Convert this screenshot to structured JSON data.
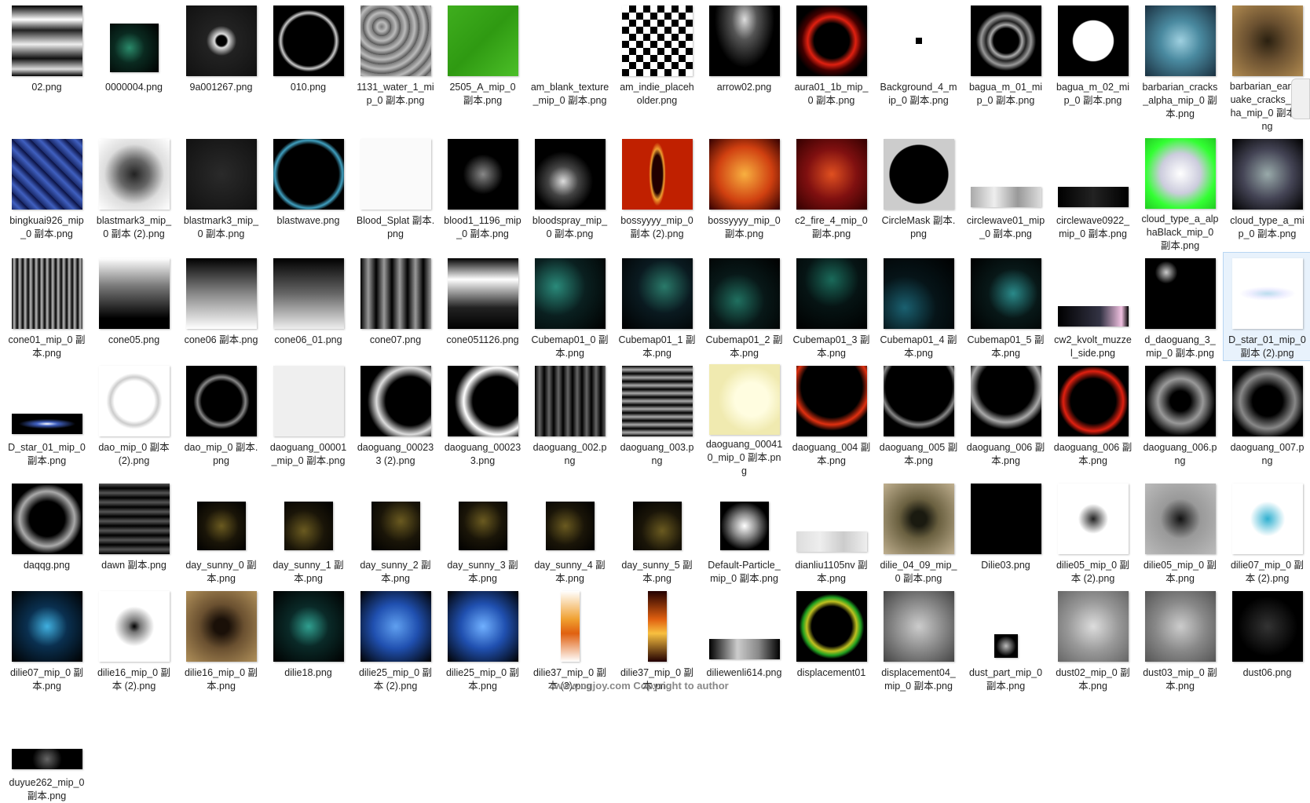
{
  "files": [
    {
      "name": "02.png",
      "bg": "linear-gradient(180deg,#000 0%,#fff 20%,#222 35%,#eee 55%,#111 75%,#ddd 90%,#000 100%)"
    },
    {
      "name": "0000004.png",
      "bg": "radial-gradient(circle at 40% 50%,#2a8a6a 0%,#0a2a20 40%,#000 100%)",
      "small": true
    },
    {
      "name": "9a001267.png",
      "bg": "radial-gradient(circle,#000 10%,#ddd 14%,#222 30%,#111 100%)"
    },
    {
      "name": "010.png",
      "bg": "radial-gradient(circle,#000 50%,#ccc 56%,#000 62%,#000 100%)"
    },
    {
      "name": "1131_water_1_mip_0 副本.png",
      "bg": "repeating-radial-gradient(circle at 30% 30%,#777 0,#bbb 6px,#555 12px)"
    },
    {
      "name": "2505_A_mip_0 副本.png",
      "bg": "linear-gradient(135deg,#3fae1e,#2f9a12,#4cbf28)"
    },
    {
      "name": "am_blank_texture_mip_0 副本.png",
      "bg": "transparent",
      "blank": true
    },
    {
      "name": "am_indie_placeholder.png",
      "bg": "repeating-conic-gradient(#000 0% 25%,#fff 0% 50%) 0 0/18px 18px"
    },
    {
      "name": "arrow02.png",
      "bg": "radial-gradient(ellipse at 50% 20%,#ddd 0%,#555 25%,#000 60%)"
    },
    {
      "name": "aura01_1b_mip_0 副本.png",
      "bg": "radial-gradient(circle,#000 35%,#e02010 48%,#400 60%,#000 75%)"
    },
    {
      "name": "Background_4_mip_0 副本.png",
      "bg": "transparent",
      "blank": true
    },
    {
      "name": "bagua_m_01_mip_0 副本.png",
      "bg": "radial-gradient(circle,#000 25%,#aaa 32%,#222 40%,#999 50%,#000 60%)"
    },
    {
      "name": "bagua_m_02_mip_0 副本.png",
      "bg": "radial-gradient(circle,#fff 40%,#000 42%,#000 100%)"
    },
    {
      "name": "barbarian_cracks_alpha_mip_0 副本.png",
      "bg": "radial-gradient(circle,#9fd0e0 0%,#4a8aa0 40%,#1a3040 100%)"
    },
    {
      "name": "barbarian_earthquake_cracks_alpha_mip_0 副本.png",
      "bg": "radial-gradient(circle,#2a2010 0%,#6a5030 40%,#b08a50 100%)"
    },
    {
      "name": "bingkuai926_mip_0 副本.png",
      "bg": "repeating-linear-gradient(45deg,#1a2a6a 0,#4060c0 8px,#0a1040 16px)"
    },
    {
      "name": "blastmark3_mip_0 副本 (2).png",
      "bg": "radial-gradient(circle,#222 0%,#666 30%,#ddd 60%,#fff 100%)"
    },
    {
      "name": "blastmark3_mip_0 副本.png",
      "bg": "radial-gradient(circle,#2a2a2a 0%,#111 100%)"
    },
    {
      "name": "blastwave.png",
      "bg": "radial-gradient(circle,#000 60%,#40a0c0 68%,#000 75%)"
    },
    {
      "name": "Blood_Splat 副本.png",
      "bg": "#fafafa"
    },
    {
      "name": "blood1_1196_mip_0 副本.png",
      "bg": "radial-gradient(circle at 50% 50%,#888 0%,#000 40%)"
    },
    {
      "name": "bloodspray_mip_0 副本.png",
      "bg": "radial-gradient(circle at 40% 60%,#ddd 0%,#444 25%,#000 50%)"
    },
    {
      "name": "bossyyyy_mip_0 副本 (2).png",
      "bg": "radial-gradient(ellipse 12% 45%,#200 60%,#f0a030 80%,#c02000 100%),radial-gradient(circle,#f8c050 0%,#e06010 50%,#fff 80%)"
    },
    {
      "name": "bossyyyy_mip_0 副本.png",
      "bg": "radial-gradient(circle,#f8b040 0%,#d04010 55%,#300 100%)"
    },
    {
      "name": "c2_fire_4_mip_0 副本.png",
      "bg": "radial-gradient(circle,#e05020 0%,#801010 50%,#300 100%)"
    },
    {
      "name": "CircleMask 副本.png",
      "bg": "radial-gradient(circle,#000 58%,#ccc 60%)"
    },
    {
      "name": "circlewave01_mip_0 副本.png",
      "bg": "transparent",
      "strip": "linear-gradient(90deg,#aaa,#eee,#999,#ddd)"
    },
    {
      "name": "circlewave0922_mip_0 副本.png",
      "bg": "transparent",
      "strip": "linear-gradient(90deg,#000,#222,#000)"
    },
    {
      "name": "cloud_type_a_alphaBlack_mip_0 副本.png",
      "bg": "radial-gradient(circle,#fff 0%,#ccd 40%,#3f3 70%,#2c2 100%)"
    },
    {
      "name": "cloud_type_a_mip_0 副本.png",
      "bg": "radial-gradient(circle,#9aa 0%,#445 50%,#000 100%)"
    },
    {
      "name": "cone01_mip_0 副本.png",
      "bg": "repeating-linear-gradient(90deg,#000 0,#bbb 3px,#000 7px)"
    },
    {
      "name": "cone05.png",
      "bg": "linear-gradient(180deg,#fff 0%,#777 40%,#000 85%)"
    },
    {
      "name": "cone06 副本.png",
      "bg": "linear-gradient(180deg,#000 0%,#888 50%,#fff 100%)"
    },
    {
      "name": "cone06_01.png",
      "bg": "linear-gradient(180deg,#000 0%,#666 50%,#eee 100%)"
    },
    {
      "name": "cone07.png",
      "bg": "repeating-linear-gradient(90deg,#000 0,#999 10px,#000 20px)"
    },
    {
      "name": "cone051126.png",
      "bg": "linear-gradient(180deg,#000 0%,#fff 30%,#222 70%,#000 100%)"
    },
    {
      "name": "Cubemap01_0 副本.png",
      "bg": "radial-gradient(circle at 30% 40%,#2a8a7a 0%,#0a2020 45%,#000 100%)"
    },
    {
      "name": "Cubemap01_1 副本.png",
      "bg": "radial-gradient(circle at 60% 40%,#2a7a6a 0%,#0a1a20 45%,#000 100%)"
    },
    {
      "name": "Cubemap01_2 副本.png",
      "bg": "radial-gradient(circle at 40% 60%,#207060 0%,#081818 45%,#000 100%)"
    },
    {
      "name": "Cubemap01_3 副本.png",
      "bg": "radial-gradient(circle at 50% 30%,#1a6a5a 0%,#061414 45%,#000 100%)"
    },
    {
      "name": "Cubemap01_4 副本.png",
      "bg": "radial-gradient(circle at 30% 70%,#1a6070 0%,#061418 45%,#000 100%)"
    },
    {
      "name": "Cubemap01_5 副本.png",
      "bg": "radial-gradient(circle at 60% 50%,#2a8a8a 0%,#081818 45%,#000 100%)"
    },
    {
      "name": "cw2_kvolt_muzzel_side.png",
      "bg": "transparent",
      "strip": "linear-gradient(90deg,#000,#334 60%,#f0c0e0 90%,#000)"
    },
    {
      "name": "d_daoguang_3_mip_0 副本.png",
      "bg": "radial-gradient(circle at 30% 20%,#ccc 0%,#000 15%),#000"
    },
    {
      "name": "D_star_01_mip_0 副本 (2).png",
      "bg": "radial-gradient(ellipse 40% 10%,#bde 0%,#eef 60%,#fff 100%)"
    },
    {
      "name": "D_star_01_mip_0 副本.png",
      "bg": "transparent",
      "strip": "radial-gradient(ellipse 50% 30%,#fff 0%,#4060c0 30%,#000 80%)"
    },
    {
      "name": "dao_mip_0 副本 (2).png",
      "bg": "radial-gradient(circle,#fff 40%,#ccc 48%,#fff 56%)"
    },
    {
      "name": "dao_mip_0 副本.png",
      "bg": "radial-gradient(circle,#000 40%,#888 48%,#000 56%)"
    },
    {
      "name": "daoguang_00001_mip_0 副本.png",
      "bg": "#efefef"
    },
    {
      "name": "daoguang_000233 (2).png",
      "bg": "radial-gradient(circle at 70% 50%,#000 40%,#ddd 55%,#000 70%)"
    },
    {
      "name": "daoguang_000233.png",
      "bg": "radial-gradient(circle at 70% 50%,#000 40%,#fff 55%,#000 70%)"
    },
    {
      "name": "daoguang_002.png",
      "bg": "repeating-linear-gradient(90deg,#000 0,#666 6px,#000 12px)"
    },
    {
      "name": "daoguang_003.png",
      "bg": "repeating-linear-gradient(0deg,#000 0,#aaa 5px,#000 10px)"
    },
    {
      "name": "daoguang_000410_mip_0 副本.png",
      "bg": "radial-gradient(circle at 60% 50%,#fffde0 30%,#f0eab0 60%)"
    },
    {
      "name": "daoguang_004 副本.png",
      "bg": "radial-gradient(circle at 50% 30%,#000 50%,#e03010 62%,#000 72%)"
    },
    {
      "name": "daoguang_005 副本.png",
      "bg": "radial-gradient(circle at 50% 30%,#000 55%,#888 62%,#000 70%)"
    },
    {
      "name": "daoguang_006 副本.png",
      "bg": "radial-gradient(circle at 50% 30%,#000 45%,#aaa 58%,#000 70%)"
    },
    {
      "name": "daoguang_006 副本.png",
      "bg": "radial-gradient(circle at 50% 50%,#000 45%,#e02010 60%,#000 70%)"
    },
    {
      "name": "daoguang_006.png",
      "bg": "radial-gradient(circle,#000 20%,#999 45%,#000 70%)"
    },
    {
      "name": "daoguang_007.png",
      "bg": "radial-gradient(circle,#000 30%,#888 55%,#000 75%)"
    },
    {
      "name": "daqqg.png",
      "bg": "radial-gradient(circle,#000 35%,#aaa 55%,#000 70%)"
    },
    {
      "name": "dawn 副本.png",
      "bg": "repeating-linear-gradient(0deg,#000 0,#555 6px,#000 12px)"
    },
    {
      "name": "day_sunny_0 副本.png",
      "bg": "radial-gradient(circle at 50% 50%,#6a5a20 0%,#1a1508 50%,#000 100%)",
      "small": true
    },
    {
      "name": "day_sunny_1 副本.png",
      "bg": "radial-gradient(circle at 40% 60%,#6a5a20 0%,#1a1508 50%,#000 100%)",
      "small": true
    },
    {
      "name": "day_sunny_2 副本.png",
      "bg": "radial-gradient(circle at 60% 40%,#6a5a20 0%,#1a1508 50%,#000 100%)",
      "small": true
    },
    {
      "name": "day_sunny_3 副本.png",
      "bg": "radial-gradient(circle at 50% 40%,#6a5a20 0%,#1a1508 50%,#000 100%)",
      "small": true
    },
    {
      "name": "day_sunny_4 副本.png",
      "bg": "radial-gradient(circle at 40% 50%,#6a5a20 0%,#1a1508 50%,#000 100%)",
      "small": true
    },
    {
      "name": "day_sunny_5 副本.png",
      "bg": "radial-gradient(circle at 60% 60%,#6a5a20 0%,#1a1508 50%,#000 100%)",
      "small": true
    },
    {
      "name": "Default-Particle_mip_0 副本.png",
      "bg": "radial-gradient(circle,#fff 0%,#888 35%,#000 70%)",
      "small": true
    },
    {
      "name": "dianliu1105nv 副本.png",
      "bg": "transparent",
      "strip": "linear-gradient(90deg,#ddd,#eee,#ccc,#eee)"
    },
    {
      "name": "dilie_04_09_mip_0 副本.png",
      "bg": "radial-gradient(circle,#1a1a10 15%,#6a6040 40%,#c0b090 100%)"
    },
    {
      "name": "Dilie03.png",
      "bg": "radial-gradient(circle,#000 0%,#000 100%)"
    },
    {
      "name": "dilie05_mip_0 副本 (2).png",
      "bg": "radial-gradient(circle,#222 0%,#fff 30%)"
    },
    {
      "name": "dilie05_mip_0 副本.png",
      "bg": "radial-gradient(circle,#111 0%,#999 40%,#bbb 100%)"
    },
    {
      "name": "dilie07_mip_0 副本 (2).png",
      "bg": "radial-gradient(circle,#30b0d0 0%,#fff 35%)"
    },
    {
      "name": "dilie07_mip_0 副本.png",
      "bg": "radial-gradient(circle,#40b0e0 0%,#0a3050 40%,#000 100%)"
    },
    {
      "name": "dilie16_mip_0 副本 (2).png",
      "bg": "radial-gradient(circle,#000 0%,#777 12%,#fff 40%)"
    },
    {
      "name": "dilie16_mip_0 副本.png",
      "bg": "radial-gradient(circle,#1a1008 15%,#6a5030 45%,#b0905a 100%)"
    },
    {
      "name": "dilie18.png",
      "bg": "radial-gradient(circle,#30a090 0%,#0a2a28 40%,#000 100%)"
    },
    {
      "name": "dilie25_mip_0 副本 (2).png",
      "bg": "radial-gradient(circle,#60a0f0 0%,#2050b0 45%,#000 100%)"
    },
    {
      "name": "dilie25_mip_0 副本.png",
      "bg": "radial-gradient(circle,#70b0ff 0%,#2050b0 45%,#000 100%)"
    },
    {
      "name": "dilie37_mip_0 副本 (2).png",
      "bg": "transparent",
      "tall": "linear-gradient(180deg,#fff,#f0a030 40%,#e06010 60%,#fff)"
    },
    {
      "name": "dilie37_mip_0 副本.png",
      "bg": "transparent",
      "tall": "linear-gradient(180deg,#200,#e06010 40%,#f8c040 60%,#200)"
    },
    {
      "name": "diliewenli614.png",
      "bg": "transparent",
      "strip": "linear-gradient(90deg,#000,#ccc 40%,#888 70%,#000)"
    },
    {
      "name": "displacement01",
      "bg": "radial-gradient(circle,#000 40%,#c0c020 50%,#20a020 58%,#000 65%)"
    },
    {
      "name": "displacement04_mip_0 副本.png",
      "bg": "radial-gradient(circle,#ccc 0%,#888 50%,#444 100%)"
    },
    {
      "name": "dust_part_mip_0 副本.png",
      "bg": "radial-gradient(circle,#bbb 0%,#000 60%)",
      "tiny": true
    },
    {
      "name": "dust02_mip_0 副本.png",
      "bg": "radial-gradient(circle,#ddd 0%,#999 50%,#666 100%)"
    },
    {
      "name": "dust03_mip_0 副本.png",
      "bg": "radial-gradient(circle,#ccc 0%,#888 50%,#555 100%)"
    },
    {
      "name": "dust06.png",
      "bg": "radial-gradient(circle,#333 0%,#000 60%)"
    },
    {
      "name": "duyue262_mip_0 副本.png",
      "bg": "transparent",
      "strip": "radial-gradient(circle,#666 0%,#000 40%)"
    }
  ],
  "selected_index": 44,
  "watermark": "www.cgjoy.com Copyright to author"
}
